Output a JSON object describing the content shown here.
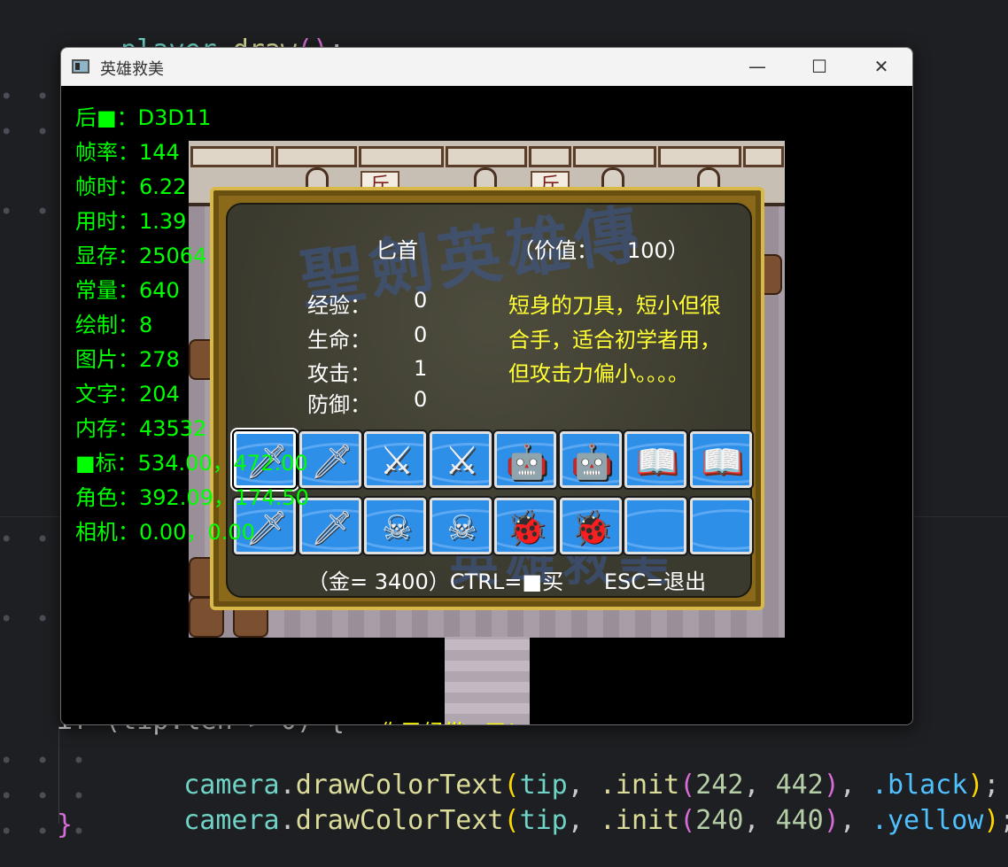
{
  "editor": {
    "top_line": {
      "obj": "player",
      "dot": ".",
      "fn": "draw",
      "open": "(",
      "close": ")",
      "semi": ";"
    },
    "partial_line": "if (tip.len > 0) {",
    "line1": {
      "obj": "camera",
      "fn": "drawColorText",
      "arg1": "tip",
      "init": ".init",
      "x": "242",
      "y": "442",
      "color": ".black"
    },
    "line2": {
      "obj": "camera",
      "fn": "drawColorText",
      "arg1": "tip",
      "init": ".init",
      "x": "240",
      "y": "440",
      "color": ".yellow"
    },
    "closing_brace": "}"
  },
  "window": {
    "title": "英雄救美",
    "minimize": "—",
    "maximize": "☐",
    "close": "✕"
  },
  "hud": [
    "后■：D3D11",
    "帧率：144",
    "帧时：6.22",
    "用时：1.39",
    "显存：25064",
    "常量：640",
    "绘制：8",
    "图片：278",
    "文字：204",
    "内存：43532",
    "■标：534.00，472.00",
    "角色：392.09，174.50",
    "相机：0.00，0.00"
  ],
  "shop": {
    "item_name": "匕首",
    "price_label": "（价值：",
    "price_value": "100）",
    "stats": [
      {
        "label": "经验：",
        "value": "0"
      },
      {
        "label": "生命：",
        "value": "0"
      },
      {
        "label": "攻击：",
        "value": "1"
      },
      {
        "label": "防御：",
        "value": "0"
      }
    ],
    "description": [
      "短身的刀具，短小但很",
      "合手，适合初学者用，",
      "但攻击力偏小。。。。"
    ],
    "footer": "（金= 3400）CTRL=■买      ESC=退出",
    "slots": [
      {
        "icon": "dagger-icon",
        "glyph": "🗡",
        "cls": "sword"
      },
      {
        "icon": "dagger-icon",
        "glyph": "🗡",
        "cls": "sword"
      },
      {
        "icon": "broadsword-icon",
        "glyph": "⚔",
        "cls": "broad"
      },
      {
        "icon": "broadsword-icon",
        "glyph": "⚔",
        "cls": "broad"
      },
      {
        "icon": "armor-icon",
        "glyph": "🤖",
        "cls": "robot"
      },
      {
        "icon": "armor-icon",
        "glyph": "🤖",
        "cls": "robot"
      },
      {
        "icon": "book-icon",
        "glyph": "📖",
        "cls": "book"
      },
      {
        "icon": "book-icon",
        "glyph": "📖",
        "cls": "book"
      },
      {
        "icon": "longsword-icon",
        "glyph": "🗡",
        "cls": "sword"
      },
      {
        "icon": "longsword-icon",
        "glyph": "🗡",
        "cls": "sword"
      },
      {
        "icon": "skull-icon",
        "glyph": "☠",
        "cls": "skull"
      },
      {
        "icon": "skull-icon",
        "glyph": "☠",
        "cls": "skull"
      },
      {
        "icon": "beetle-icon",
        "glyph": "🐞",
        "cls": "bug"
      },
      {
        "icon": "beetle-icon",
        "glyph": "🐞",
        "cls": "bug"
      },
      {
        "icon": "empty-slot-icon",
        "glyph": "",
        "cls": ""
      },
      {
        "icon": "empty-slot-icon",
        "glyph": "",
        "cls": ""
      }
    ],
    "shop_sign": "斤"
  },
  "toast": "你已经带■了！"
}
